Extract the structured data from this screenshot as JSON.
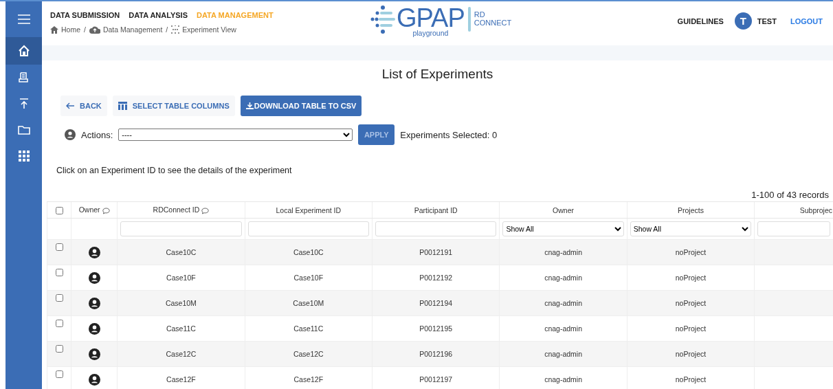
{
  "sidebar": {
    "items": [
      {
        "selected": true
      },
      {
        "selected": false
      },
      {
        "selected": false
      },
      {
        "selected": false
      },
      {
        "selected": false
      }
    ]
  },
  "nav": {
    "items": [
      {
        "label": "DATA SUBMISSION",
        "selected": false
      },
      {
        "label": "DATA ANALYSIS",
        "selected": false
      },
      {
        "label": "DATA MANAGEMENT",
        "selected": true
      }
    ]
  },
  "breadcrumb": [
    {
      "kind": "link",
      "label": "Home"
    },
    {
      "kind": "separator",
      "label": "/"
    },
    {
      "kind": "link",
      "label": "Data Management"
    },
    {
      "kind": "separator",
      "label": "/"
    },
    {
      "kind": "link",
      "label": "Experiment View"
    }
  ],
  "logo": {
    "name": "GPAP",
    "sub": "playground",
    "side": [
      "RD",
      "CONNECT"
    ]
  },
  "user_bar": {
    "guidelines": "GUIDELINES",
    "avatar": "T",
    "user": "TEST",
    "logout": "LOGOUT"
  },
  "title": "List of Experiments",
  "toolbar": {
    "back": "BACK",
    "columns": "SELECT TABLE COLUMNS",
    "download": "DOWNLOAD TABLE TO CSV"
  },
  "actions": {
    "label": "Actions:",
    "value": "----",
    "apply": "APPLY",
    "apply_disabled": true,
    "selected_count": "Experiments Selected: 0"
  },
  "hint": "Click on an Experiment ID to see the details of the experiment",
  "records": "1-100 of 43 records",
  "table": {
    "select_all": false,
    "columns": [
      {
        "label": "Owner",
        "info": true,
        "kind": "icon"
      },
      {
        "label": "RDConnect ID",
        "info": true,
        "kind": "text"
      },
      {
        "label": "Local Experiment ID",
        "info": false,
        "kind": "text"
      },
      {
        "label": "Participant ID",
        "info": false,
        "kind": "text"
      },
      {
        "label": "Owner",
        "info": false,
        "kind": "select",
        "value": "Show All"
      },
      {
        "label": "Projects",
        "info": false,
        "kind": "select",
        "value": "Show All"
      },
      {
        "label": "Subprojec",
        "info": false,
        "kind": "text"
      }
    ],
    "rows": [
      {
        "checked": false,
        "cells": [
          "",
          "Case10C",
          "Case10C",
          "P0012191",
          "cnag-admin",
          "noProject"
        ]
      },
      {
        "checked": false,
        "cells": [
          "",
          "Case10F",
          "Case10F",
          "P0012192",
          "cnag-admin",
          "noProject"
        ]
      },
      {
        "checked": false,
        "cells": [
          "",
          "Case10M",
          "Case10M",
          "P0012194",
          "cnag-admin",
          "noProject"
        ]
      },
      {
        "checked": false,
        "cells": [
          "",
          "Case11C",
          "Case11C",
          "P0012195",
          "cnag-admin",
          "noProject"
        ]
      },
      {
        "checked": false,
        "cells": [
          "",
          "Case12C",
          "Case12C",
          "P0012196",
          "cnag-admin",
          "noProject"
        ]
      },
      {
        "checked": false,
        "cells": [
          "",
          "Case12F",
          "Case12F",
          "P0012197",
          "cnag-admin",
          "noProject"
        ]
      }
    ]
  }
}
